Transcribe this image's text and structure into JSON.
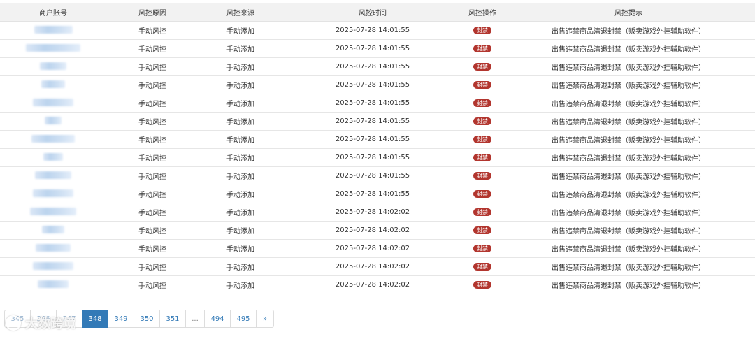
{
  "table": {
    "headers": {
      "account": "商户账号",
      "reason": "风控原因",
      "source": "风控来源",
      "time": "风控时间",
      "operation": "风控操作",
      "tip": "风控提示"
    },
    "rows": [
      {
        "reason": "手动风控",
        "source": "手动添加",
        "time": "2025-07-28 14:01:55",
        "operation": "封禁",
        "tip": "出售违禁商品清退封禁（贩卖游戏外挂辅助软件）"
      },
      {
        "reason": "手动风控",
        "source": "手动添加",
        "time": "2025-07-28 14:01:55",
        "operation": "封禁",
        "tip": "出售违禁商品清退封禁（贩卖游戏外挂辅助软件）"
      },
      {
        "reason": "手动风控",
        "source": "手动添加",
        "time": "2025-07-28 14:01:55",
        "operation": "封禁",
        "tip": "出售违禁商品清退封禁（贩卖游戏外挂辅助软件）"
      },
      {
        "reason": "手动风控",
        "source": "手动添加",
        "time": "2025-07-28 14:01:55",
        "operation": "封禁",
        "tip": "出售违禁商品清退封禁（贩卖游戏外挂辅助软件）"
      },
      {
        "reason": "手动风控",
        "source": "手动添加",
        "time": "2025-07-28 14:01:55",
        "operation": "封禁",
        "tip": "出售违禁商品清退封禁（贩卖游戏外挂辅助软件）"
      },
      {
        "reason": "手动风控",
        "source": "手动添加",
        "time": "2025-07-28 14:01:55",
        "operation": "封禁",
        "tip": "出售违禁商品清退封禁（贩卖游戏外挂辅助软件）"
      },
      {
        "reason": "手动风控",
        "source": "手动添加",
        "time": "2025-07-28 14:01:55",
        "operation": "封禁",
        "tip": "出售违禁商品清退封禁（贩卖游戏外挂辅助软件）"
      },
      {
        "reason": "手动风控",
        "source": "手动添加",
        "time": "2025-07-28 14:01:55",
        "operation": "封禁",
        "tip": "出售违禁商品清退封禁（贩卖游戏外挂辅助软件）"
      },
      {
        "reason": "手动风控",
        "source": "手动添加",
        "time": "2025-07-28 14:01:55",
        "operation": "封禁",
        "tip": "出售违禁商品清退封禁（贩卖游戏外挂辅助软件）"
      },
      {
        "reason": "手动风控",
        "source": "手动添加",
        "time": "2025-07-28 14:01:55",
        "operation": "封禁",
        "tip": "出售违禁商品清退封禁（贩卖游戏外挂辅助软件）"
      },
      {
        "reason": "手动风控",
        "source": "手动添加",
        "time": "2025-07-28 14:02:02",
        "operation": "封禁",
        "tip": "出售违禁商品清退封禁（贩卖游戏外挂辅助软件）"
      },
      {
        "reason": "手动风控",
        "source": "手动添加",
        "time": "2025-07-28 14:02:02",
        "operation": "封禁",
        "tip": "出售违禁商品清退封禁（贩卖游戏外挂辅助软件）"
      },
      {
        "reason": "手动风控",
        "source": "手动添加",
        "time": "2025-07-28 14:02:02",
        "operation": "封禁",
        "tip": "出售违禁商品清退封禁（贩卖游戏外挂辅助软件）"
      },
      {
        "reason": "手动风控",
        "source": "手动添加",
        "time": "2025-07-28 14:02:02",
        "operation": "封禁",
        "tip": "出售违禁商品清退封禁（贩卖游戏外挂辅助软件）"
      },
      {
        "reason": "手动风控",
        "source": "手动添加",
        "time": "2025-07-28 14:02:02",
        "operation": "封禁",
        "tip": "出售违禁商品清退封禁（贩卖游戏外挂辅助软件）"
      }
    ]
  },
  "pagination": {
    "pages": [
      "345",
      "346",
      "347",
      "348",
      "349",
      "350",
      "351",
      "...",
      "494",
      "495"
    ],
    "current": "348",
    "next_label": "»"
  },
  "watermark": {
    "text": "大数跨境"
  },
  "colors": {
    "accent": "#337ab7",
    "source_text": "#d9262b",
    "ban_badge": "#b2352e"
  }
}
